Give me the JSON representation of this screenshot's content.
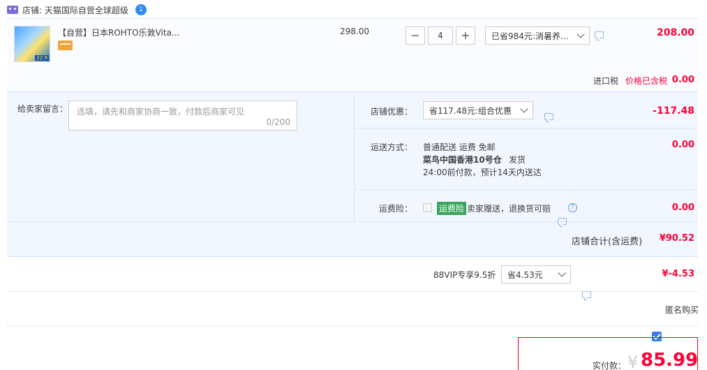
{
  "shop": {
    "label": "店铺: 天猫国际自营全球超级",
    "badge": "1"
  },
  "item": {
    "thumb_tag": "22.9",
    "title": "【自营】日本ROHTO乐敦Vita...",
    "unit_price": "298.00",
    "quantity": "4",
    "promo_select": "已省984元:消暑养...",
    "subtotal": "208.00",
    "import_tax_label": "进口税",
    "import_tax_note": "价格已含税",
    "import_tax_value": "0.00"
  },
  "message": {
    "label": "给卖家留言：",
    "placeholder": "选填，请先和商家协商一致，付款后商家可见",
    "counter": "0/200"
  },
  "shop_discount": {
    "label": "店铺优惠：",
    "select": "省117.48元:组合优惠",
    "value": "-117.48"
  },
  "shipping": {
    "label": "运送方式：",
    "line1": "普通配送 运费 免邮",
    "line2_bold": "菜鸟中国香港10号仓",
    "line2_rest": "发货",
    "line3": "24:00前付款，预计14天内送达",
    "value": "0.00"
  },
  "insurance": {
    "label": "运费险：",
    "tag": "运费险",
    "text": "卖家赠送，退换货可赔",
    "help": "?",
    "value": "0.00"
  },
  "shop_total": {
    "label": "店铺合计(含运费)",
    "value": "¥90.52"
  },
  "vip": {
    "label": "88VIP专享9.5折",
    "select": "省4.53元",
    "value": "¥-4.53"
  },
  "anonymous": {
    "label": "匿名购买",
    "checked": true
  },
  "payment": {
    "label": "实付款：",
    "currency": "¥",
    "amount": "85.99"
  },
  "colors": {
    "accent_red": "#ff0036",
    "light_blue": "#f2f7ff",
    "brand_blue": "#3d7bf0"
  }
}
